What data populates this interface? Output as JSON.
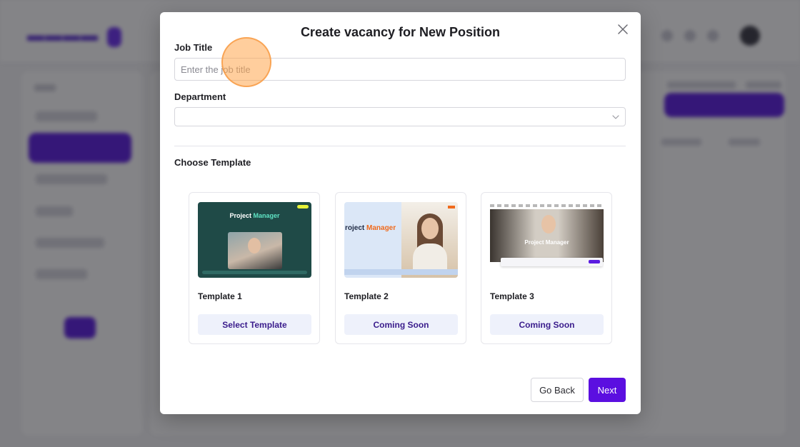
{
  "modal": {
    "title": "Create vacancy for New Position",
    "close_icon": "close-icon"
  },
  "form": {
    "job_title": {
      "label": "Job Title",
      "placeholder": "Enter the job title",
      "value": ""
    },
    "department": {
      "label": "Department",
      "value": "",
      "icon": "chevron-down-icon"
    }
  },
  "templates": {
    "heading": "Choose Template",
    "items": [
      {
        "name": "Template 1",
        "button": "Select Template",
        "thumb_title_a": "Project ",
        "thumb_title_b": "Manager"
      },
      {
        "name": "Template 2",
        "button": "Coming Soon",
        "thumb_title_a": "roject ",
        "thumb_title_b": "Manager"
      },
      {
        "name": "Template 3",
        "button": "Coming Soon",
        "thumb_title_a": "Project Manager",
        "thumb_title_b": ""
      }
    ]
  },
  "footer": {
    "back_label": "Go Back",
    "next_label": "Next"
  },
  "colors": {
    "accent": "#5b0fe0",
    "template_button_bg": "#eef1fb",
    "template_button_text": "#3a1c8c",
    "cursor_highlight": "#ffa64d"
  }
}
